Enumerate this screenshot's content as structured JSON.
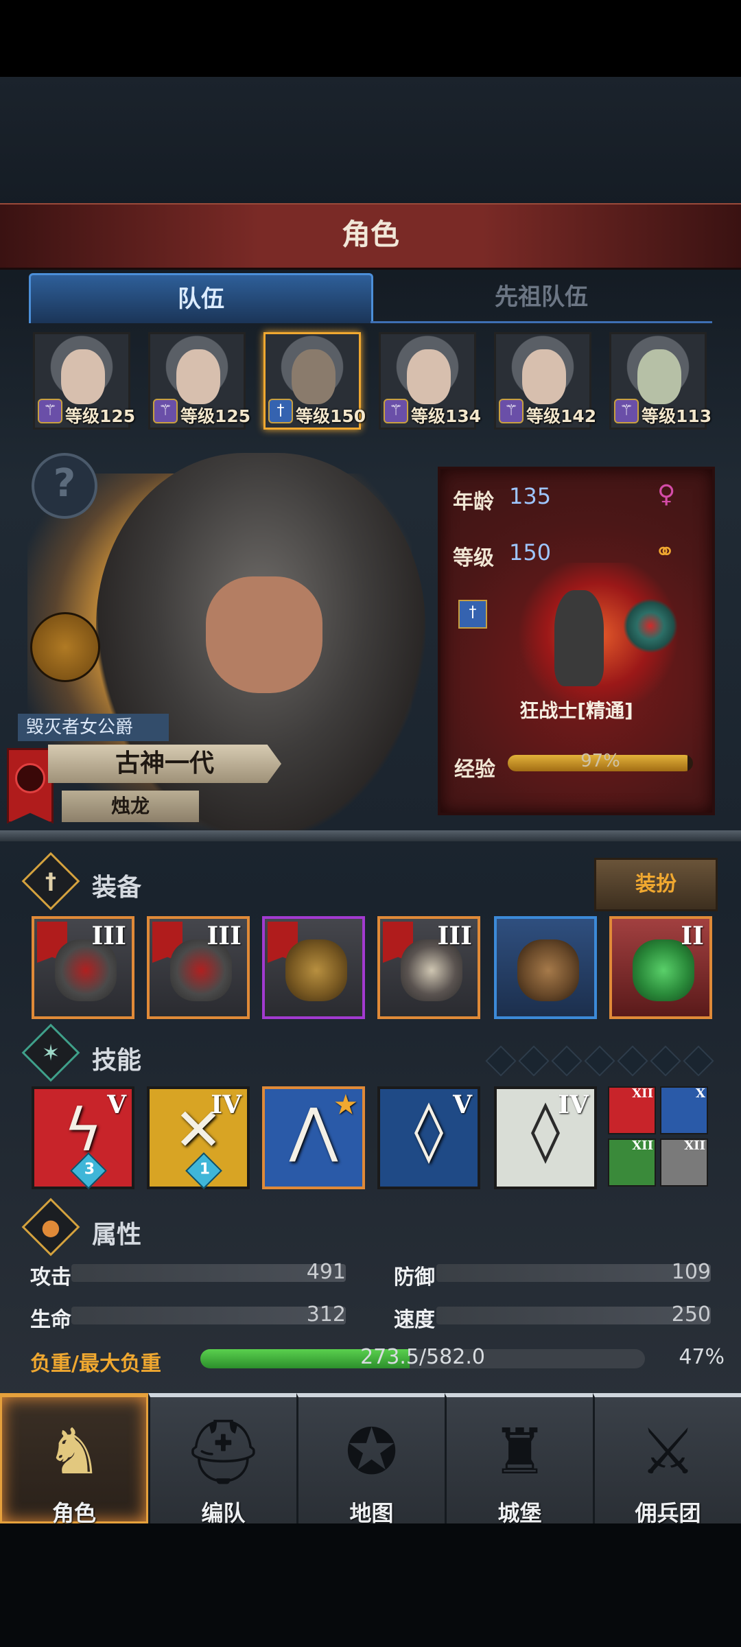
{
  "header": {
    "title": "角色"
  },
  "tabs": [
    {
      "label": "队伍",
      "active": true
    },
    {
      "label": "先祖队伍",
      "active": false
    }
  ],
  "party": [
    {
      "level": "等级125",
      "class_icon": "staff-icon"
    },
    {
      "level": "等级125",
      "class_icon": "staff-icon"
    },
    {
      "level": "等级150",
      "class_icon": "sword-icon",
      "selected": true
    },
    {
      "level": "等级134",
      "class_icon": "staff-icon"
    },
    {
      "level": "等级142",
      "class_icon": "staff-icon"
    },
    {
      "level": "等级113",
      "class_icon": "staff-icon"
    }
  ],
  "character": {
    "title": "毁灭者女公爵",
    "name": "古神一代",
    "subtitle": "烛龙",
    "age_label": "年龄",
    "age": "135",
    "level_label": "等级",
    "level": "150",
    "gender_icon": "female-icon",
    "ring_icon": "ring-icon",
    "class_name": "狂战士[精通]",
    "exp_label": "经验",
    "exp_text": "97%",
    "exp_percent": 97
  },
  "equipment": {
    "title": "装备",
    "dress_button": "装扮",
    "slots": [
      {
        "tier": "III",
        "rarity": "orange",
        "icon": "mace-icon"
      },
      {
        "tier": "III",
        "rarity": "orange",
        "icon": "mace-icon"
      },
      {
        "tier": "",
        "rarity": "purple",
        "icon": "helmet-icon"
      },
      {
        "tier": "III",
        "rarity": "orange",
        "icon": "armor-icon"
      },
      {
        "tier": "",
        "rarity": "blue",
        "icon": "boots-icon"
      },
      {
        "tier": "II",
        "rarity": "orange",
        "icon": "jade-icon"
      }
    ]
  },
  "skills": {
    "title": "技能",
    "points_total": 7,
    "items": [
      {
        "tier": "V",
        "count": "3",
        "color": "#c8242a",
        "icon": "slash-sword-icon"
      },
      {
        "tier": "IV",
        "count": "1",
        "color": "#d8a424",
        "icon": "cross-strike-icon"
      },
      {
        "tier": "★",
        "count": "",
        "color": "#2a5aa8",
        "icon": "claw-icon",
        "selected": true
      },
      {
        "tier": "V",
        "count": "",
        "color": "#1f4a86",
        "icon": "crystal-sword-icon"
      },
      {
        "tier": "IV",
        "count": "",
        "color": "#d9ddd6",
        "icon": "crystal-arm-icon"
      }
    ],
    "mini": [
      {
        "tier": "XII",
        "color": "#c8242a",
        "icon": "sword-icon"
      },
      {
        "tier": "X",
        "color": "#2a5aa8",
        "icon": "burst-icon"
      },
      {
        "tier": "XII",
        "color": "#3a8a3a",
        "icon": "claw-icon"
      },
      {
        "tier": "XII",
        "color": "#7a7a7a",
        "icon": "shield-icon"
      }
    ]
  },
  "attributes": {
    "title": "属性",
    "stats": [
      {
        "label": "攻击",
        "value": "491"
      },
      {
        "label": "防御",
        "value": "109"
      },
      {
        "label": "生命",
        "value": "312"
      },
      {
        "label": "速度",
        "value": "250"
      }
    ],
    "load_label": "负重/最大负重",
    "load_text": "273.5/582.0",
    "load_percent_text": "47%",
    "load_percent": 47
  },
  "nav": [
    {
      "label": "角色",
      "icon": "knight-icon",
      "active": true
    },
    {
      "label": "编队",
      "icon": "helmet-icon"
    },
    {
      "label": "地图",
      "icon": "compass-icon"
    },
    {
      "label": "城堡",
      "icon": "castle-icon"
    },
    {
      "label": "佣兵团",
      "icon": "mercenary-icon"
    }
  ],
  "colors": {
    "accent": "#f0a830",
    "tab_blue": "#4c8fd8",
    "panel_red": "#4b1717"
  }
}
